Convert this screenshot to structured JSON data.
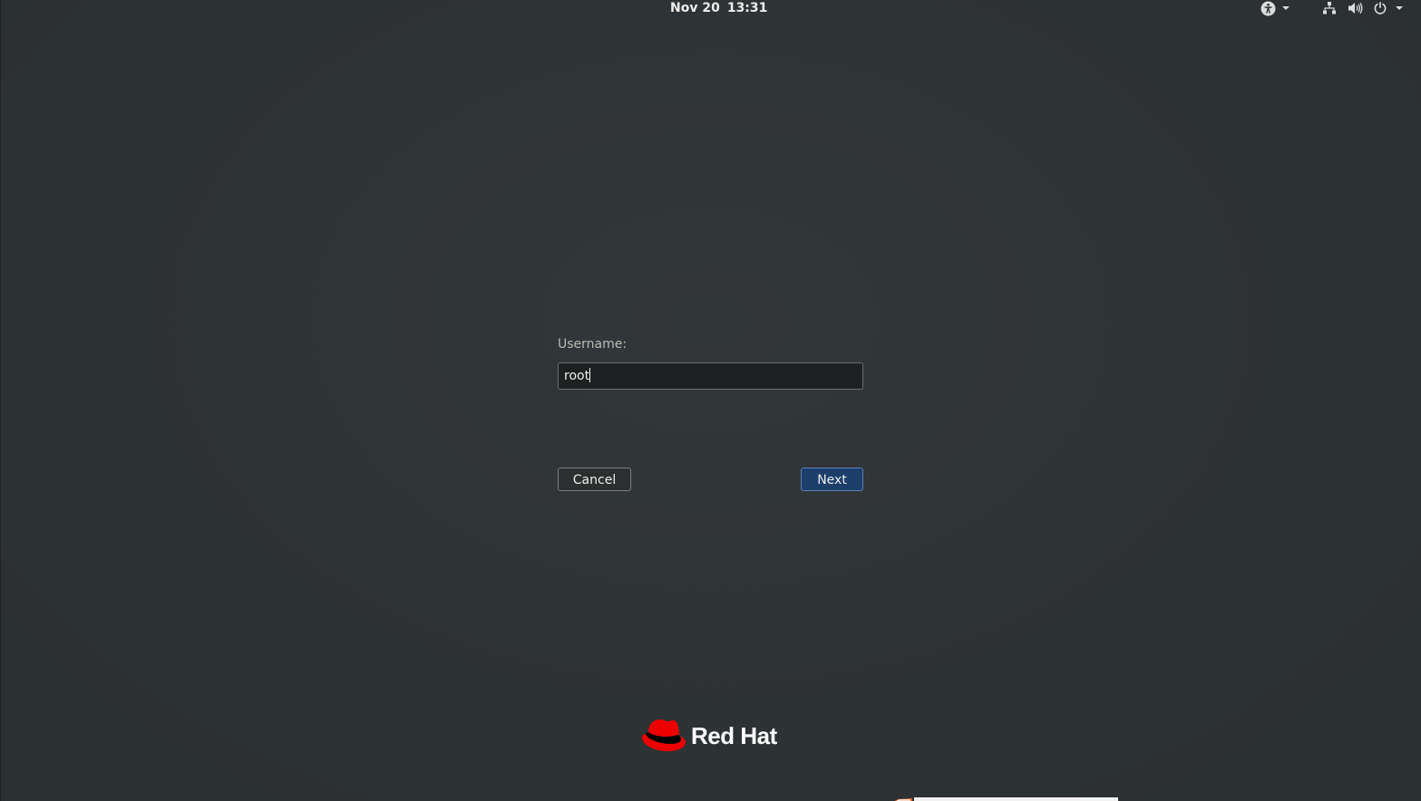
{
  "topbar": {
    "date": "Nov 20",
    "time": "13:31",
    "icons": [
      "accessibility-icon",
      "network-icon",
      "volume-icon",
      "power-icon"
    ]
  },
  "login": {
    "username_label": "Username:",
    "username_value": "root",
    "cancel_label": "Cancel",
    "next_label": "Next"
  },
  "branding": {
    "logo_text": "Red Hat",
    "logo_color": "#ee0000"
  },
  "colors": {
    "background": "#2e3436",
    "accent_button": "#1c3e6a",
    "text": "#eeeeec"
  }
}
